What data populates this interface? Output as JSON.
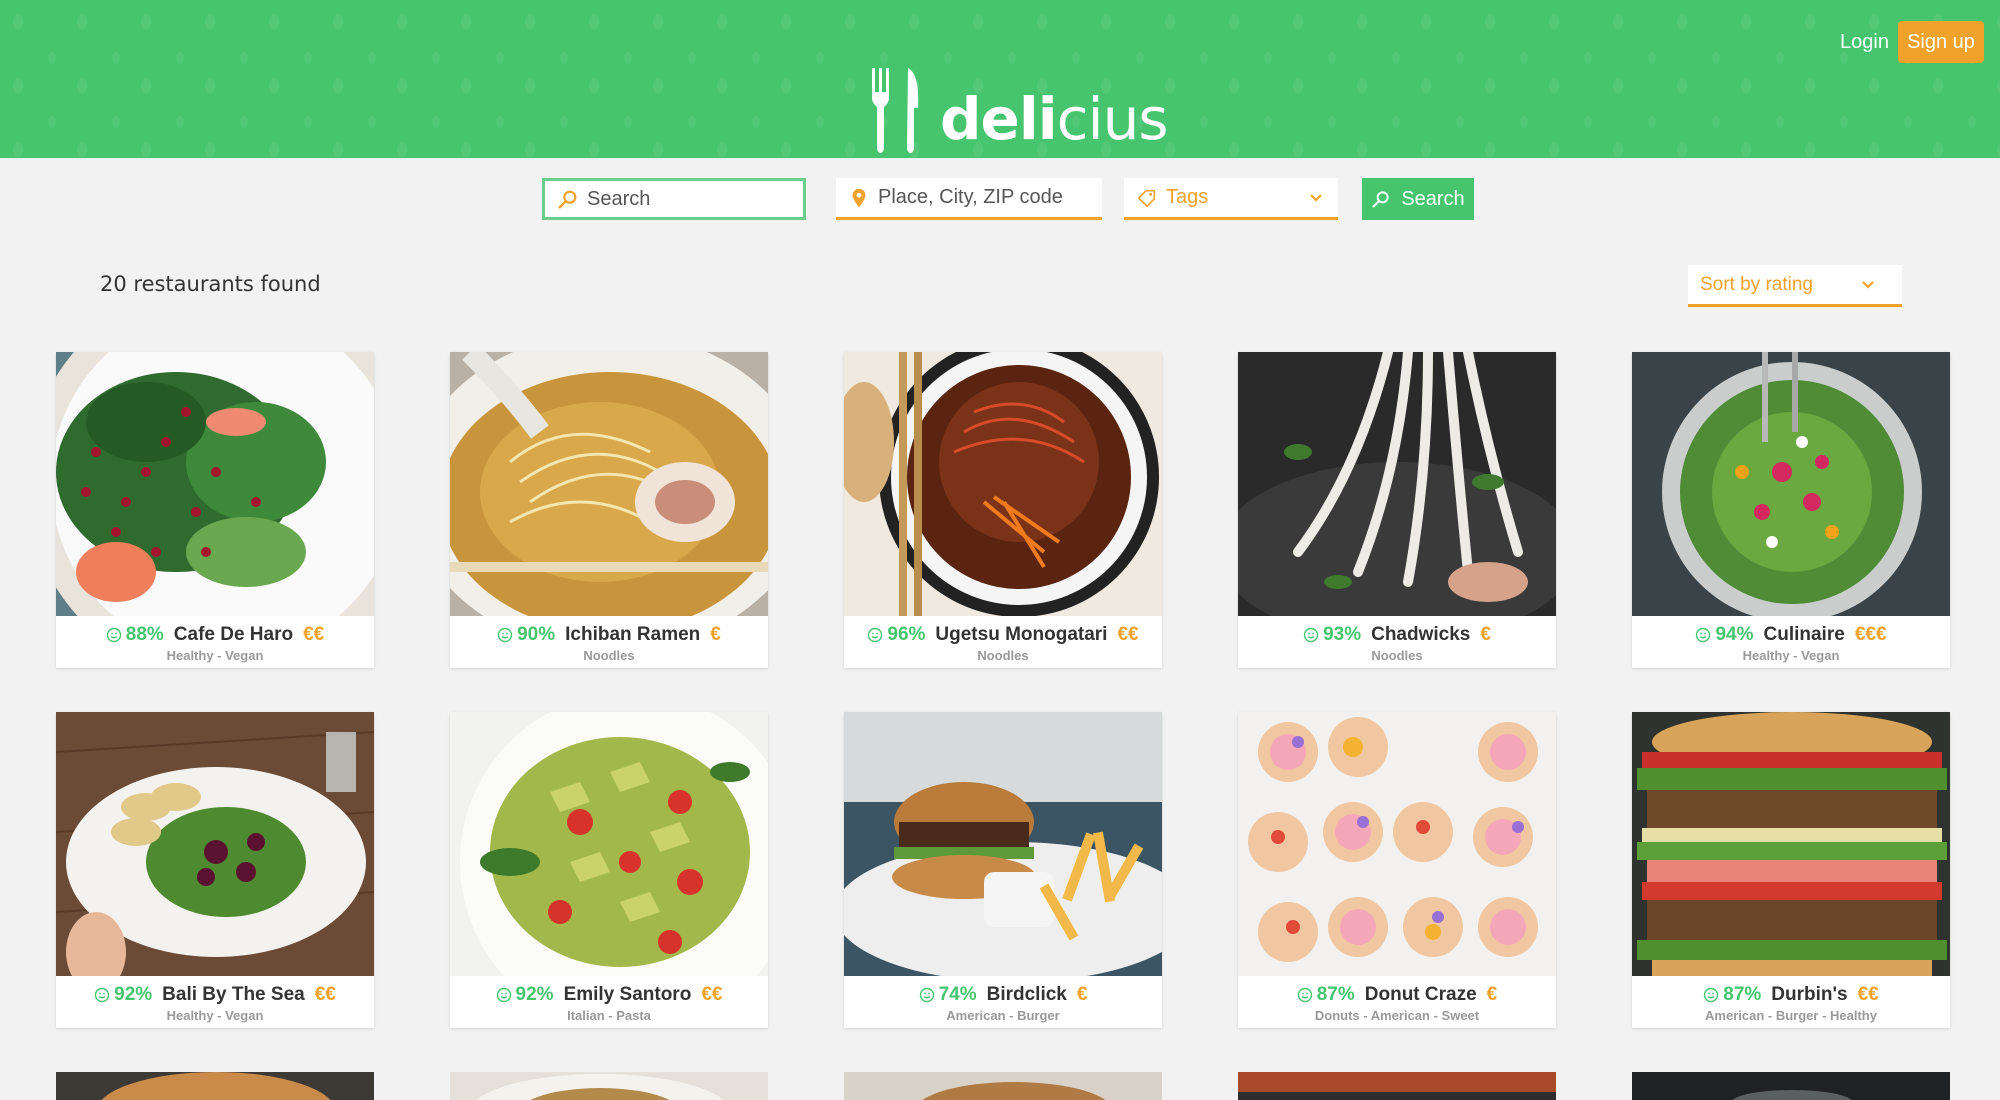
{
  "header": {
    "logo_text_bold": "deli",
    "logo_text_light": "cius",
    "login_label": "Login",
    "signup_label": "Sign up",
    "background_color": "#46c56e",
    "accent_color": "#f1a22a"
  },
  "search": {
    "query_placeholder": "Search",
    "location_placeholder": "Place, City, ZIP code",
    "tags_label": "Tags",
    "button_label": "Search"
  },
  "results": {
    "count_text": "20 restaurants found",
    "sort_label": "Sort by rating"
  },
  "restaurants": [
    {
      "rating": "88%",
      "name": "Cafe De Haro",
      "price": "€€",
      "tags": "Healthy - Vegan",
      "photo": "salad-pomegranate"
    },
    {
      "rating": "90%",
      "name": "Ichiban Ramen",
      "price": "€",
      "tags": "Noodles",
      "photo": "ramen-bowl"
    },
    {
      "rating": "96%",
      "name": "Ugetsu Monogatari",
      "price": "€€",
      "tags": "Noodles",
      "photo": "spicy-noodle-bowl"
    },
    {
      "rating": "93%",
      "name": "Chadwicks",
      "price": "€",
      "tags": "Noodles",
      "photo": "udon-noodles"
    },
    {
      "rating": "94%",
      "name": "Culinaire",
      "price": "€€€",
      "tags": "Healthy - Vegan",
      "photo": "flower-salad-bowl"
    },
    {
      "rating": "92%",
      "name": "Bali By The Sea",
      "price": "€€",
      "tags": "Healthy - Vegan",
      "photo": "beet-salad-plate"
    },
    {
      "rating": "92%",
      "name": "Emily Santoro",
      "price": "€€",
      "tags": "Italian - Pasta",
      "photo": "pesto-pasta"
    },
    {
      "rating": "74%",
      "name": "Birdclick",
      "price": "€",
      "tags": "American - Burger",
      "photo": "burger-fries"
    },
    {
      "rating": "87%",
      "name": "Donut Craze",
      "price": "€",
      "tags": "Donuts - American - Sweet",
      "photo": "decorated-donuts"
    },
    {
      "rating": "87%",
      "name": "Durbin's",
      "price": "€€",
      "tags": "American - Burger - Healthy",
      "photo": "veggie-burger-stack"
    }
  ]
}
